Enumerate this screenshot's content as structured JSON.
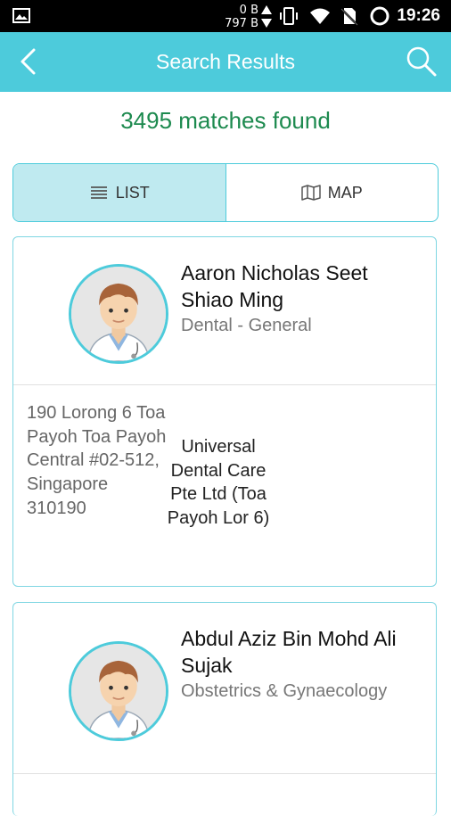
{
  "status_bar": {
    "net_up": "0 B",
    "net_down": "797 B",
    "time": "19:26",
    "icons": [
      "image-notification-icon",
      "vibrate-icon",
      "wifi-icon",
      "no-sim-icon",
      "battery-ring-icon"
    ]
  },
  "header": {
    "title": "Search Results",
    "back_icon": "chevron-left-icon",
    "search_icon": "search-icon"
  },
  "results": {
    "count_text": "3495 matches found"
  },
  "view_toggle": {
    "list_label": "LIST",
    "map_label": "MAP",
    "selected": "LIST"
  },
  "doctors": [
    {
      "name": "Aaron Nicholas Seet Shiao Ming",
      "specialty": "Dental - General",
      "address": "190 Lorong 6 Toa Payoh Toa Payoh Central #02-512, Singapore 310190",
      "clinic": "Universal Dental Care Pte Ltd (Toa Payoh Lor 6)"
    },
    {
      "name": "Abdul Aziz Bin Mohd Ali Sujak",
      "specialty": "Obstetrics & Gynaecology"
    }
  ],
  "colors": {
    "accent": "#4dcbdb",
    "count_text": "#1d8a4f",
    "toggle_active": "#bfeaf0"
  }
}
